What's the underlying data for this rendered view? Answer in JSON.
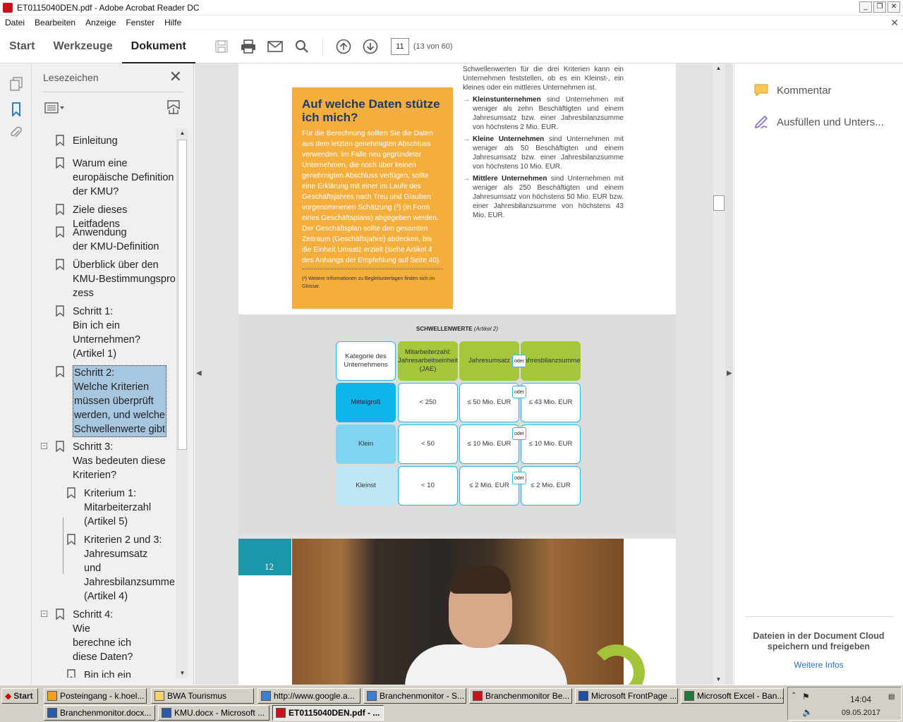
{
  "window": {
    "title": "ET0115040DEN.pdf - Adobe Acrobat Reader DC",
    "controls": {
      "minimize": "_",
      "restore": "❐",
      "close": "✕"
    }
  },
  "menu": [
    "Datei",
    "Bearbeiten",
    "Anzeige",
    "Fenster",
    "Hilfe"
  ],
  "toolbar": {
    "tabs": [
      "Start",
      "Werkzeuge",
      "Dokument"
    ],
    "active_tab": "Dokument",
    "page_number": "11",
    "page_count": "(13 von 60)"
  },
  "bookmarks": {
    "title": "Lesezeichen",
    "items": [
      {
        "label": "Einleitung"
      },
      {
        "label": "Warum eine\neuropäische Definition\nder KMU?"
      },
      {
        "label": "Ziele dieses Leitfadens"
      },
      {
        "label": "Anwendung\nder KMU-Definition"
      },
      {
        "label": "Überblick über den\nKMU-Bestimmungspro\nzess"
      },
      {
        "label": "Schritt 1:\nBin ich ein\nUnternehmen?\n(Artikel 1)"
      },
      {
        "label": "Schritt 2:\nWelche Kriterien\nmüssen überprüft\nwerden, und welche\nSchwellenwerte gibt",
        "selected": true
      },
      {
        "label": "Schritt 3:\nWas bedeuten diese\nKriterien?"
      },
      {
        "label": "Kriterium 1:\nMitarbeiterzahl\n(Artikel 5)"
      },
      {
        "label": "Kriterien 2 und 3:\nJahresumsatz\nund\nJahresbilanzsumme\n(Artikel 4)"
      },
      {
        "label": "Schritt 4:\nWie\nberechne ich\ndiese Daten?"
      },
      {
        "label": "Bin ich ein"
      }
    ]
  },
  "document": {
    "box": {
      "heading": "Auf welche Daten stütze ich mich?",
      "body": "Für die Berechnung sollten Sie die Daten aus dem letzten genehmigten Abschluss verwenden. Im Falle neu gegründeter Unternehmen, die noch über keinen genehmigten Abschluss verfügen, sollte eine Erklärung mit einer im Laufe des Geschäftsjahres nach Treu und Glauben vorgenommenen Schätzung (²) (in Form eines Geschäftsplans) abgegeben werden. Der Geschäftsplan sollte den gesamten Zeitraum (Geschäftsjahre) abdecken, bis die Einheit Umsatz erzielt (siehe Artikel 4 des Anhangs der Empfehlung auf Seite 40).",
      "footnote": "(²) Weitere Informationen zu Begleitunterlagen finden sich im Glossar."
    },
    "right_intro": "Schwellenwerten für die drei Kriterien kann ein Unternehmen feststellen, ob es ein Kleinst-, ein kleines oder ein mittleres Unternehmen ist.",
    "right_items": [
      {
        "term": "Kleinstunternehmen",
        "text": " sind Unternehmen mit weniger als zehn Beschäftigten und einem Jahresumsatz bzw. einer Jahresbilanzsumme von höchstens 2 Mio. EUR."
      },
      {
        "term": "Kleine Unternehmen",
        "text": " sind Unternehmen mit weniger als 50 Beschäftigten und einem Jahresumsatz bzw. einer Jahresbilanzsumme von höchstens 10 Mio. EUR."
      },
      {
        "term": "Mittlere Unternehmen",
        "text": " sind Unternehmen mit weniger als 250 Beschäftigten und einem Jahresumsatz von höchstens 50 Mio. EUR bzw. einer Jahresbilanzsumme von höchstens 43 Mio. EUR."
      }
    ],
    "table": {
      "title": "SCHWELLENWERTE",
      "title_note": "(Artikel 2)",
      "headers": [
        "Kategorie des Unternehmens",
        "Mitarbeiterzahl: Jahresarbeitseinheit (JAE)",
        "Jahresumsatz",
        "Jahresbilanzsumme"
      ],
      "rows": [
        {
          "category": "Mittelgroß",
          "staff": "< 250",
          "turnover": "≤ 50 Mio. EUR",
          "balance": "≤ 43 Mio. EUR"
        },
        {
          "category": "Klein",
          "staff": "< 50",
          "turnover": "≤ 10 Mio. EUR",
          "balance": "≤ 10 Mio. EUR"
        },
        {
          "category": "Kleinst",
          "staff": "< 10",
          "turnover": "≤ 2 Mio. EUR",
          "balance": "≤ 2 Mio. EUR"
        }
      ],
      "oder": "oder"
    },
    "next_page_number": "12"
  },
  "right_panel": {
    "comment": "Kommentar",
    "fill_sign": "Ausfüllen und Unters...",
    "cloud_text": "Dateien in der Document Cloud speichern und freigeben",
    "more_info": "Weitere Infos"
  },
  "taskbar": {
    "start": "Start",
    "row1": [
      "Posteingang - k.hoel...",
      "BWA Tourismus",
      "http://www.google.a...",
      "Branchenmonitor - S...",
      "Branchenmonitor Be...",
      "Microsoft FrontPage ...",
      "Microsoft Excel - Ban..."
    ],
    "row2": [
      "Branchenmonitor.docx...",
      "KMU.docx - Microsoft ...",
      "ET0115040DEN.pdf - ..."
    ],
    "time": "14:04",
    "date": "09.05.2017"
  }
}
